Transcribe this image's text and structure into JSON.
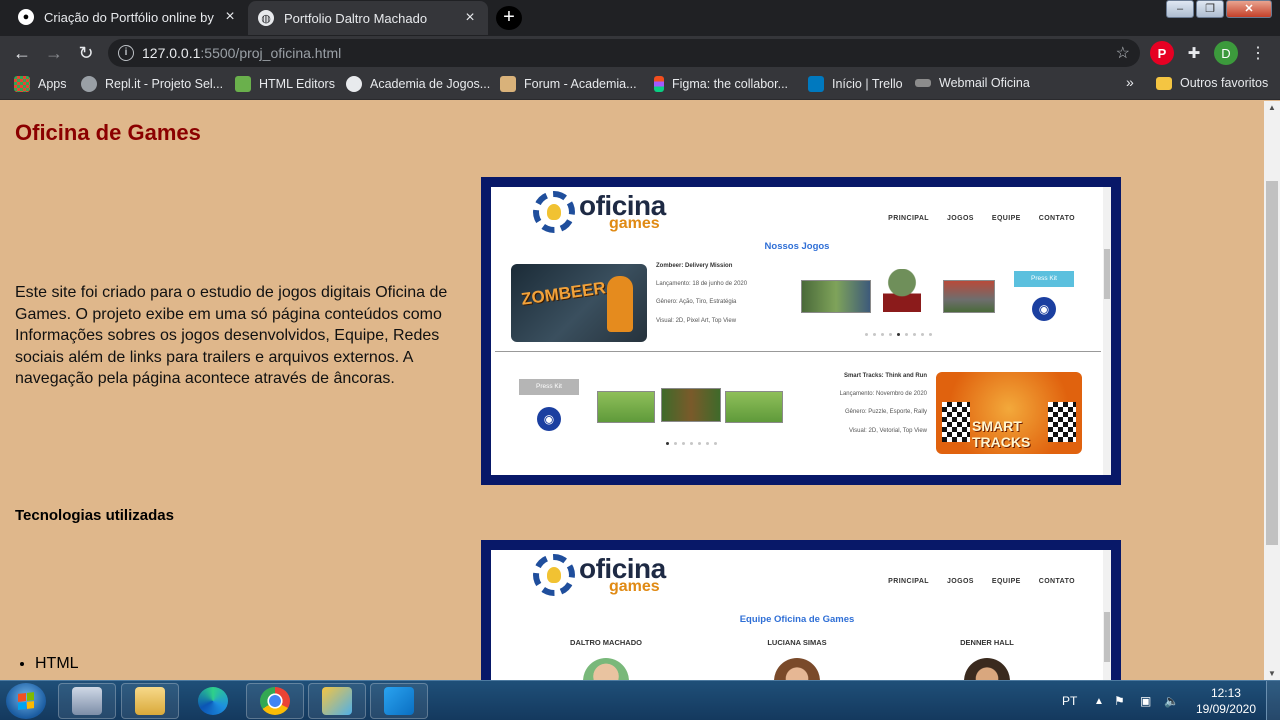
{
  "browser": {
    "tabs": [
      {
        "title": "Criação do Portfólio online by da",
        "active": false,
        "icon": "github-icon"
      },
      {
        "title": "Portfolio Daltro Machado",
        "active": true,
        "icon": "globe-icon"
      }
    ],
    "new_tab_label": "+",
    "url_host": "127.0.0.1",
    "url_path": ":5500/proj_oficina.html",
    "profile_initial": "D",
    "bookmarks": [
      {
        "label": "Apps",
        "icon": "apps-grid-icon"
      },
      {
        "label": "Repl.it - Projeto Sel...",
        "icon": "replit-icon"
      },
      {
        "label": "HTML Editors",
        "icon": "html-editors-icon"
      },
      {
        "label": "Academia de Jogos...",
        "icon": "globe-icon"
      },
      {
        "label": "Forum - Academia...",
        "icon": "forum-icon"
      },
      {
        "label": "Figma: the collabor...",
        "icon": "figma-icon"
      },
      {
        "label": "Início | Trello",
        "icon": "trello-icon"
      },
      {
        "label": "Webmail Oficina",
        "icon": "webmail-icon"
      }
    ],
    "bookmarks_overflow": "»",
    "other_bookmarks": "Outros favoritos"
  },
  "page": {
    "title": "Oficina de Games",
    "description": "Este site foi criado para o estudio de jogos digitais Oficina de Games. O projeto exibe em uma só página conteúdos como Informações sobres os jogos desenvolvidos, Equipe, Redes sociais além de links para trailers e arquivos externos. A navegação pela página acontece através de âncoras.",
    "tech_title": "Tecnologias utilizadas",
    "tech_list": [
      "HTML"
    ]
  },
  "screenshot1": {
    "logo_main": "oficina",
    "logo_sub": "games",
    "nav": [
      "PRINCIPAL",
      "JOGOS",
      "EQUIPE",
      "CONTATO"
    ],
    "heading": "Nossos Jogos",
    "game1": {
      "thumb_label": "ZOMBEER",
      "title": "Zombeer: Delivery Mission",
      "release": "Lançamento: 18 de junho de 2020",
      "genre": "Gênero: Ação, Tiro, Estratégia",
      "visual": "Visual: 2D, Pixel Art, Top View"
    },
    "game2": {
      "thumb_label": "SMART TRACKS",
      "title": "Smart Tracks: Think and Run",
      "release": "Lançamento: Novembro de 2020",
      "genre": "Gênero: Puzzle, Esporte, Rally",
      "visual": "Visual: 2D, Vetorial, Top View"
    },
    "press_kit": "Press Kit"
  },
  "screenshot2": {
    "logo_main": "oficina",
    "logo_sub": "games",
    "nav": [
      "PRINCIPAL",
      "JOGOS",
      "EQUIPE",
      "CONTATO"
    ],
    "heading": "Equipe Oficina de Games",
    "members": [
      "DALTRO MACHADO",
      "LUCIANA SIMAS",
      "DENNER HALL"
    ]
  },
  "taskbar": {
    "language": "PT",
    "time": "12:13",
    "date": "19/09/2020",
    "apps": [
      "keyboard-app-icon",
      "file-explorer-icon",
      "edge-icon",
      "chrome-icon",
      "tool-app-icon",
      "vscode-icon"
    ]
  }
}
